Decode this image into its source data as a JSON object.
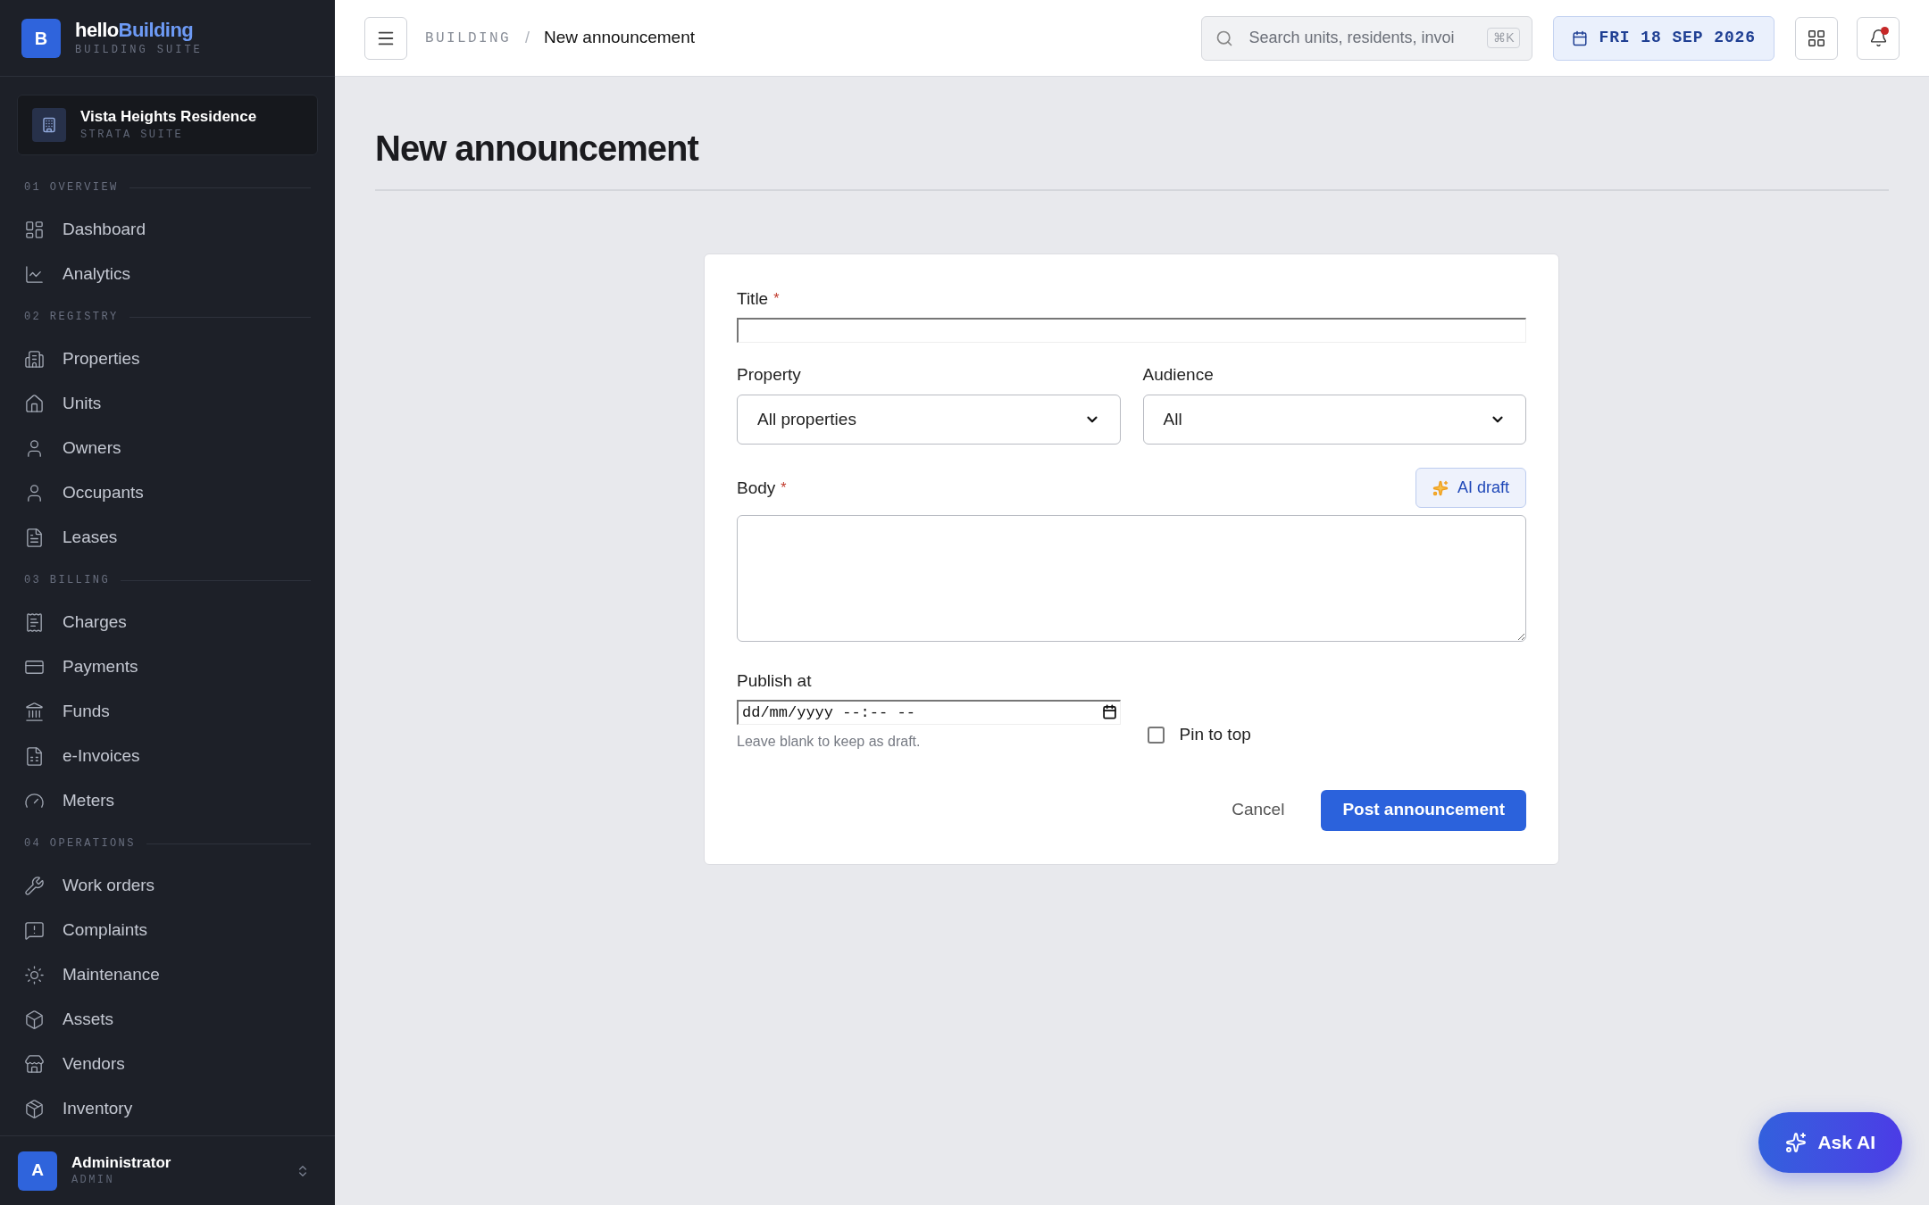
{
  "brand": {
    "logo_letter": "B",
    "name_part1": "hello",
    "name_part2": "Building",
    "tagline": "BUILDING SUITE"
  },
  "property_switcher": {
    "name": "Vista Heights Residence",
    "subtitle": "STRATA SUITE"
  },
  "sidebar": {
    "sections": [
      {
        "number": "01",
        "title": "OVERVIEW",
        "items": [
          {
            "label": "Dashboard",
            "selected": false
          },
          {
            "label": "Analytics",
            "selected": false
          }
        ]
      },
      {
        "number": "02",
        "title": "REGISTRY",
        "items": [
          {
            "label": "Properties",
            "selected": false
          },
          {
            "label": "Units",
            "selected": false
          },
          {
            "label": "Owners",
            "selected": false
          },
          {
            "label": "Occupants",
            "selected": false
          },
          {
            "label": "Leases",
            "selected": false
          }
        ]
      },
      {
        "number": "03",
        "title": "BILLING",
        "items": [
          {
            "label": "Charges",
            "selected": false
          },
          {
            "label": "Payments",
            "selected": false
          },
          {
            "label": "Funds",
            "selected": false
          },
          {
            "label": "e-Invoices",
            "selected": false
          },
          {
            "label": "Meters",
            "selected": false
          }
        ]
      },
      {
        "number": "04",
        "title": "OPERATIONS",
        "items": [
          {
            "label": "Work orders",
            "selected": false
          },
          {
            "label": "Complaints",
            "selected": false
          },
          {
            "label": "Maintenance",
            "selected": false
          },
          {
            "label": "Assets",
            "selected": false
          },
          {
            "label": "Vendors",
            "selected": false
          },
          {
            "label": "Inventory",
            "selected": false
          }
        ]
      }
    ]
  },
  "user": {
    "avatar_letter": "A",
    "name": "Administrator",
    "role": "ADMIN"
  },
  "header": {
    "breadcrumb": [
      "BUILDING",
      "New announcement"
    ],
    "breadcrumb_separator": "/",
    "search": {
      "placeholder": "Search units, residents, invoi",
      "shortcut": "⌘K"
    },
    "date": "FRI 18 SEP 2026",
    "notifications_unread": true
  },
  "page": {
    "title": "New announcement"
  },
  "form": {
    "title_field": {
      "label": "Title",
      "required_mark": "*"
    },
    "property": {
      "label": "Property",
      "value": "All properties"
    },
    "audience": {
      "label": "Audience",
      "value": "All"
    },
    "body": {
      "label": "Body",
      "required_mark": "*",
      "ai_button": "AI draft"
    },
    "publish_at": {
      "label": "Publish at",
      "placeholder": "dd/mm/yyyy --:-- --",
      "help": "Leave blank to keep as draft."
    },
    "pin_to_top": {
      "label": "Pin to top",
      "checked": false
    },
    "cancel": "Cancel",
    "submit": "Post announcement"
  },
  "ask_ai": "Ask AI"
}
